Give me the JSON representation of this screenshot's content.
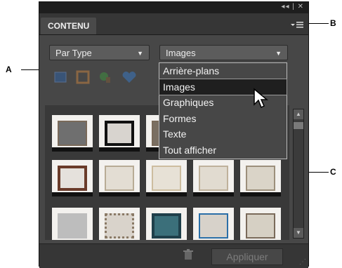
{
  "callouts": {
    "a": "A",
    "b": "B",
    "c": "C"
  },
  "window": {
    "controls": "◂◂ | ✕"
  },
  "tab": {
    "title": "CONTENU"
  },
  "filters": {
    "type": {
      "value": "Par Type"
    },
    "category": {
      "value": "Images"
    }
  },
  "menu": {
    "items": [
      "Arrière-plans",
      "Images",
      "Graphiques",
      "Formes",
      "Texte",
      "Tout afficher"
    ],
    "selected": "Images"
  },
  "footer": {
    "apply": "Appliquer"
  }
}
